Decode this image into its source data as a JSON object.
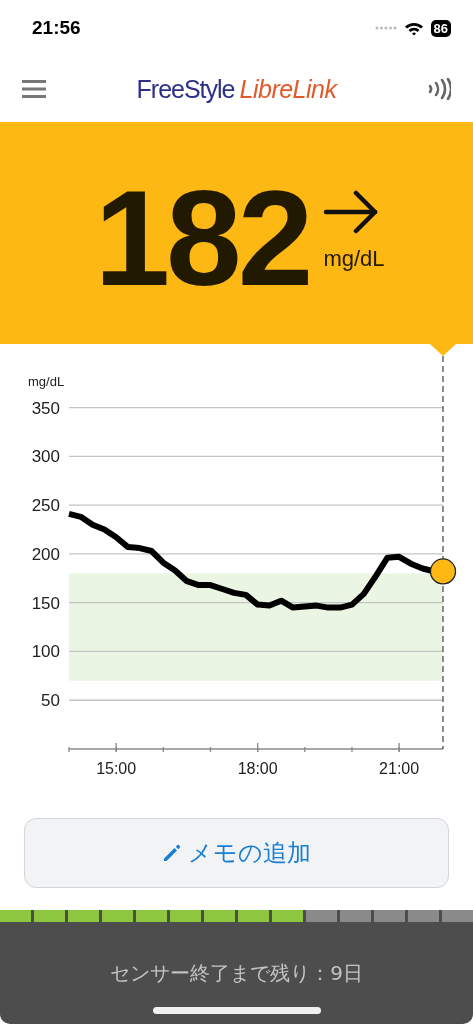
{
  "status_bar": {
    "time": "21:56",
    "battery": "86"
  },
  "header": {
    "logo_part_1": "FreeStyle",
    "logo_part_2": "LibreLink"
  },
  "reading": {
    "value": "182",
    "unit": "mg/dL"
  },
  "chart": {
    "chart_data": {
      "type": "line",
      "ylabel": "mg/dL",
      "x": [
        14.0,
        14.25,
        14.5,
        14.75,
        15.0,
        15.25,
        15.5,
        15.75,
        16.0,
        16.25,
        16.5,
        16.75,
        17.0,
        17.25,
        17.5,
        17.75,
        18.0,
        18.25,
        18.5,
        18.75,
        19.0,
        19.25,
        19.5,
        19.75,
        20.0,
        20.25,
        20.5,
        20.75,
        21.0,
        21.25,
        21.5,
        21.75,
        21.93
      ],
      "series": [
        {
          "color": "#000000",
          "values": [
            241,
            238,
            230,
            225,
            217,
            207,
            206,
            203,
            191,
            183,
            172,
            168,
            168,
            164,
            160,
            158,
            148,
            147,
            152,
            145,
            146,
            147,
            145,
            145,
            148,
            159,
            177,
            196,
            197,
            190,
            185,
            182,
            182
          ]
        }
      ],
      "xlim": [
        14,
        21.93
      ],
      "ylim": [
        0,
        350
      ],
      "grid": true,
      "xticks": [
        {
          "value": 15,
          "label": "15:00"
        },
        {
          "value": 18,
          "label": "18:00"
        },
        {
          "value": 21,
          "label": "21:00"
        }
      ],
      "yticks": [
        50,
        100,
        150,
        200,
        250,
        300,
        350
      ],
      "bands": [
        {
          "axis": "y",
          "from": 70,
          "to": 180,
          "color": "#ebf5e4"
        }
      ]
    }
  },
  "memo_button": {
    "label": "メモの追加"
  },
  "sensor": {
    "segments": [
      {
        "active": true
      },
      {
        "active": true
      },
      {
        "active": true
      },
      {
        "active": true
      },
      {
        "active": true
      },
      {
        "active": true
      },
      {
        "active": true
      },
      {
        "active": true
      },
      {
        "active": true
      },
      {
        "active": false
      },
      {
        "active": false
      },
      {
        "active": false
      },
      {
        "active": false
      },
      {
        "active": false
      }
    ],
    "message": "センサー終了まで残り：9日"
  }
}
